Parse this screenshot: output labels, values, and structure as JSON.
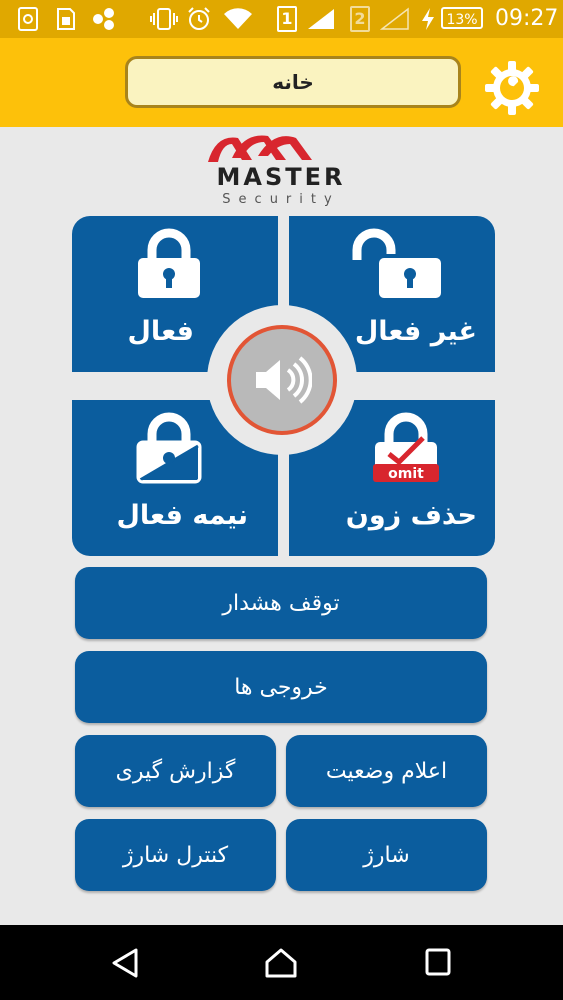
{
  "status_bar": {
    "sim_slot_1": "1",
    "sim_slot_2": "2",
    "battery": "13%",
    "time": "09:27"
  },
  "header": {
    "title": "خانه",
    "settings_icon": "gear-wrench-icon"
  },
  "logo": {
    "brand": "MASTER",
    "tagline": "Security"
  },
  "tiles": {
    "arm": {
      "label": "فعال",
      "icon": "lock-closed-icon"
    },
    "disarm": {
      "label": "غیر فعال",
      "icon": "lock-open-icon"
    },
    "partial": {
      "label": "نیمه فعال",
      "icon": "lock-half-icon"
    },
    "omit_zone": {
      "label": "حذف زون",
      "icon": "lock-omit-icon",
      "badge": "omit"
    }
  },
  "center": {
    "icon": "speaker-icon"
  },
  "buttons": {
    "stop_alarm": "توقف هشدار",
    "outputs": "خروجی ها",
    "reporting": "گزارش گیری",
    "status_report": "اعلام وضعیت",
    "charge_control": "کنترل شارژ",
    "charge": "شارژ"
  },
  "colors": {
    "statusbar": "#e0a800",
    "appbar": "#fdc10a",
    "tile": "#0b5d9e",
    "speaker_border": "#e25535",
    "logo_red": "#d8262e"
  }
}
